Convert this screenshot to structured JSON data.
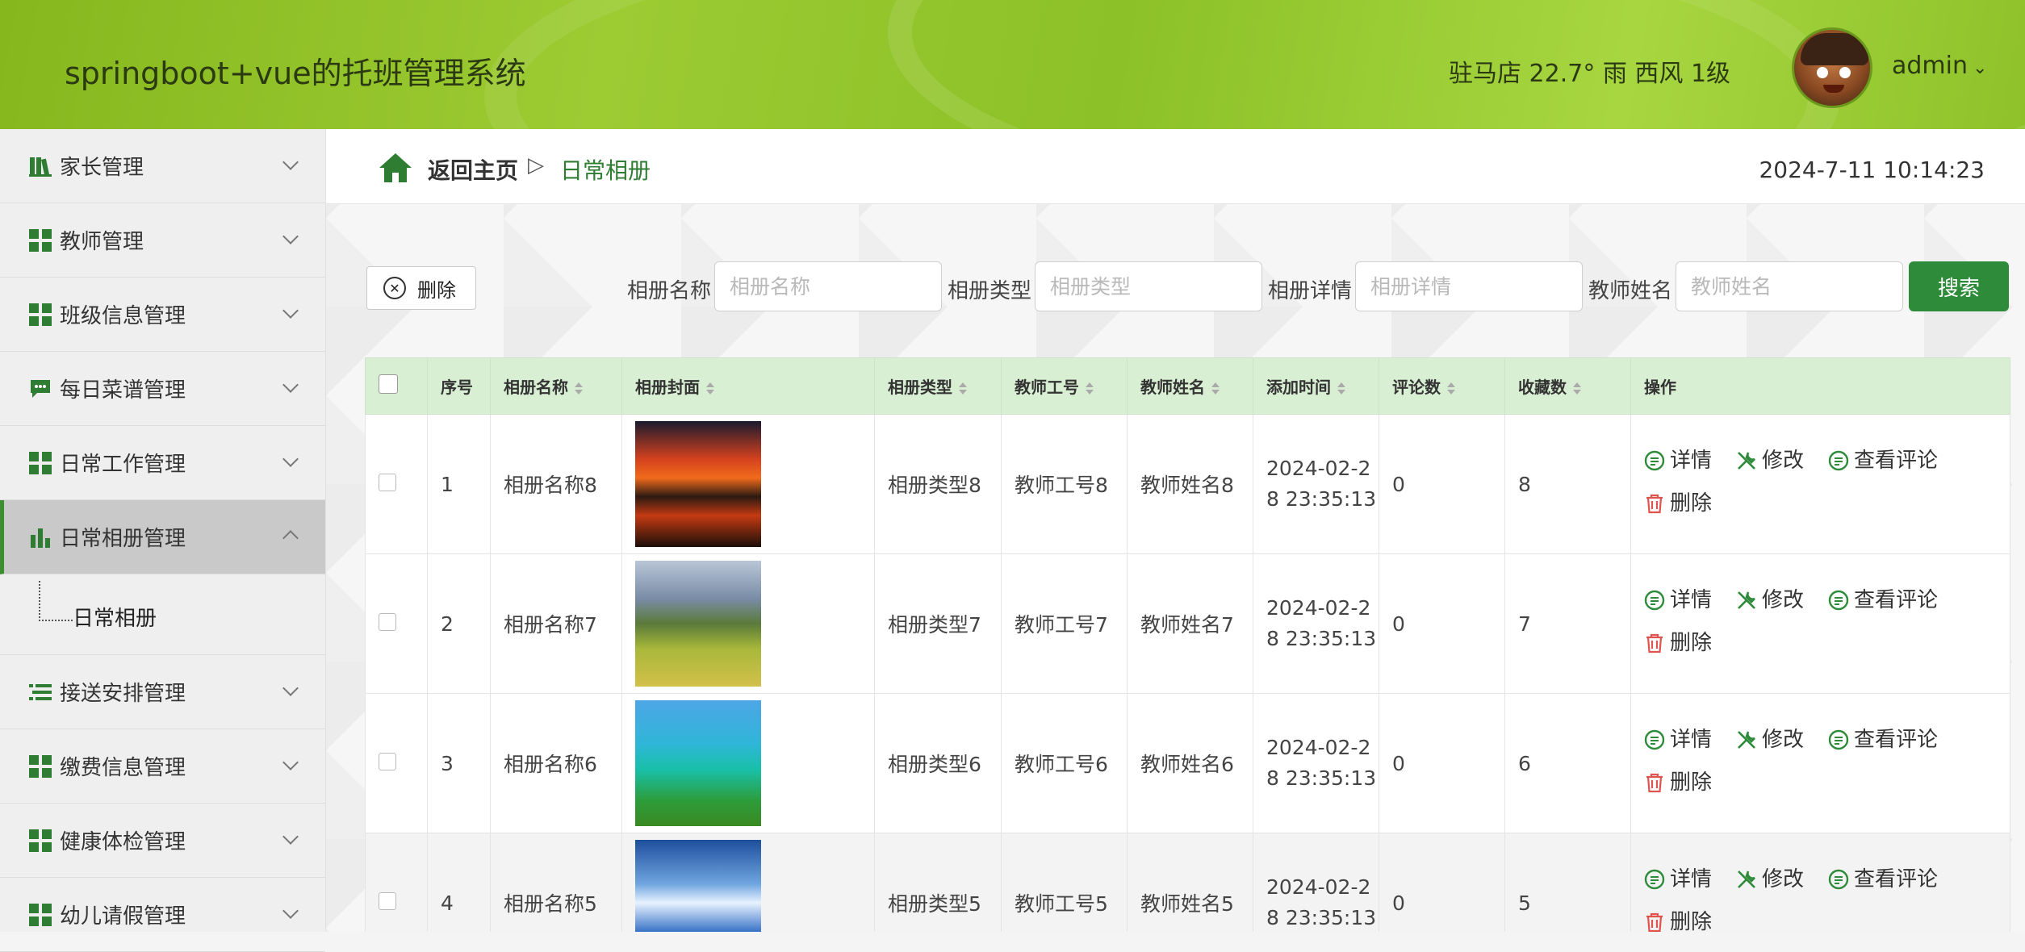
{
  "header": {
    "title": "springboot+vue的托班管理系统",
    "weather": "驻马店  22.7°  雨  西风  1级",
    "username": "admin",
    "caret": "⌄"
  },
  "sidebar": {
    "items": [
      {
        "label": "家长管理",
        "icon": "book-icon"
      },
      {
        "label": "教师管理",
        "icon": "grid-icon"
      },
      {
        "label": "班级信息管理",
        "icon": "grid-icon"
      },
      {
        "label": "每日菜谱管理",
        "icon": "chat-icon"
      },
      {
        "label": "日常工作管理",
        "icon": "grid-icon"
      },
      {
        "label": "日常相册管理",
        "icon": "bar-chart-icon",
        "active": true
      },
      {
        "label": "接送安排管理",
        "icon": "list-icon"
      },
      {
        "label": "缴费信息管理",
        "icon": "grid-icon"
      },
      {
        "label": "健康体检管理",
        "icon": "grid-icon"
      },
      {
        "label": "幼儿请假管理",
        "icon": "grid-icon"
      }
    ],
    "submenu_label": "日常相册"
  },
  "breadcrumb": {
    "home": "返回主页",
    "sep": "▷",
    "current": "日常相册"
  },
  "datetime": "2024-7-11 10:14:23",
  "toolbar": {
    "delete_label": "删除",
    "search_label": "搜索",
    "fields": [
      {
        "label": "相册名称",
        "placeholder": "相册名称"
      },
      {
        "label": "相册类型",
        "placeholder": "相册类型"
      },
      {
        "label": "相册详情",
        "placeholder": "相册详情"
      },
      {
        "label": "教师姓名",
        "placeholder": "教师姓名"
      }
    ]
  },
  "table": {
    "headers": [
      "序号",
      "相册名称",
      "相册封面",
      "相册类型",
      "教师工号",
      "教师姓名",
      "添加时间",
      "评论数",
      "收藏数",
      "操作"
    ],
    "rows": [
      {
        "idx": "1",
        "name": "相册名称8",
        "type": "相册类型8",
        "tno": "教师工号8",
        "tname": "教师姓名8",
        "time": "2024-02-28 23:35:13",
        "comments": "0",
        "favs": "8"
      },
      {
        "idx": "2",
        "name": "相册名称7",
        "type": "相册类型7",
        "tno": "教师工号7",
        "tname": "教师姓名7",
        "time": "2024-02-28 23:35:13",
        "comments": "0",
        "favs": "7"
      },
      {
        "idx": "3",
        "name": "相册名称6",
        "type": "相册类型6",
        "tno": "教师工号6",
        "tname": "教师姓名6",
        "time": "2024-02-28 23:35:13",
        "comments": "0",
        "favs": "6"
      },
      {
        "idx": "4",
        "name": "相册名称5",
        "type": "相册类型5",
        "tno": "教师工号5",
        "tname": "教师姓名5",
        "time": "2024-02-28 23:35:13",
        "comments": "0",
        "favs": "5"
      }
    ],
    "ops": {
      "detail": "详情",
      "edit": "修改",
      "comments": "查看评论",
      "delete": "删除"
    }
  },
  "colors": {
    "accent": "#2e8b3a",
    "header_green": "#9ccb32",
    "table_header": "#d9efd4",
    "delete_red": "#e0544f"
  }
}
